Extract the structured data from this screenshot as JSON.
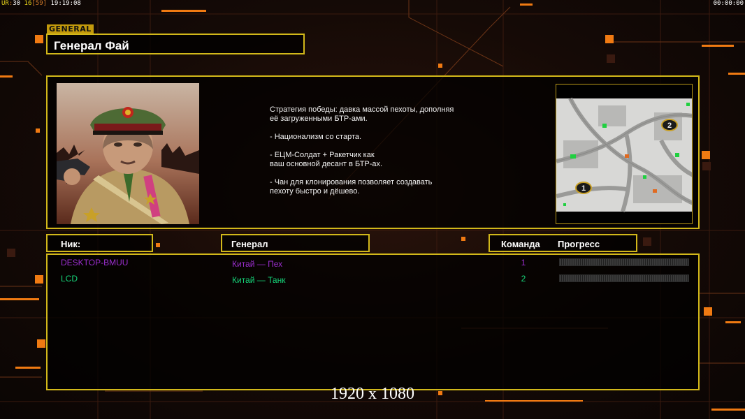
{
  "hud": {
    "ur_label": "UR",
    "ur_value": "30",
    "fps": "16",
    "fps_bracket": "[59]",
    "clock": "19:19:08",
    "timer": "00:00:00"
  },
  "general": {
    "tag": "GENERAL",
    "name": "Генерал Фай"
  },
  "description": "Стратегия победы: давка массой пехоты, дополняя\n её загруженными БТР-ами.\n\n- Национализм со старта.\n\n- ЕЦМ-Солдат + Ракетчик как\nваш основной десант в БТР-ах.\n\n- Чан для клонирования позволяет создавать\n пехоту быстро и дёшево.",
  "minimap": {
    "marker_1": "1",
    "marker_2": "2"
  },
  "columns": {
    "nick": "Ник:",
    "general": "Генерал",
    "team": "Команда",
    "progress": "Прогресс"
  },
  "players": [
    {
      "nick": "DESKTOP-BMUU",
      "general": "Китай — Пех",
      "team": "1",
      "color": "#9b2ecf"
    },
    {
      "nick": "LCD",
      "general": "Китай — Танк",
      "team": "2",
      "color": "#16d67a"
    }
  ],
  "resolution": "1920 x 1080",
  "colors": {
    "frame": "#d2b81a",
    "accent_orange": "#f07a12"
  }
}
